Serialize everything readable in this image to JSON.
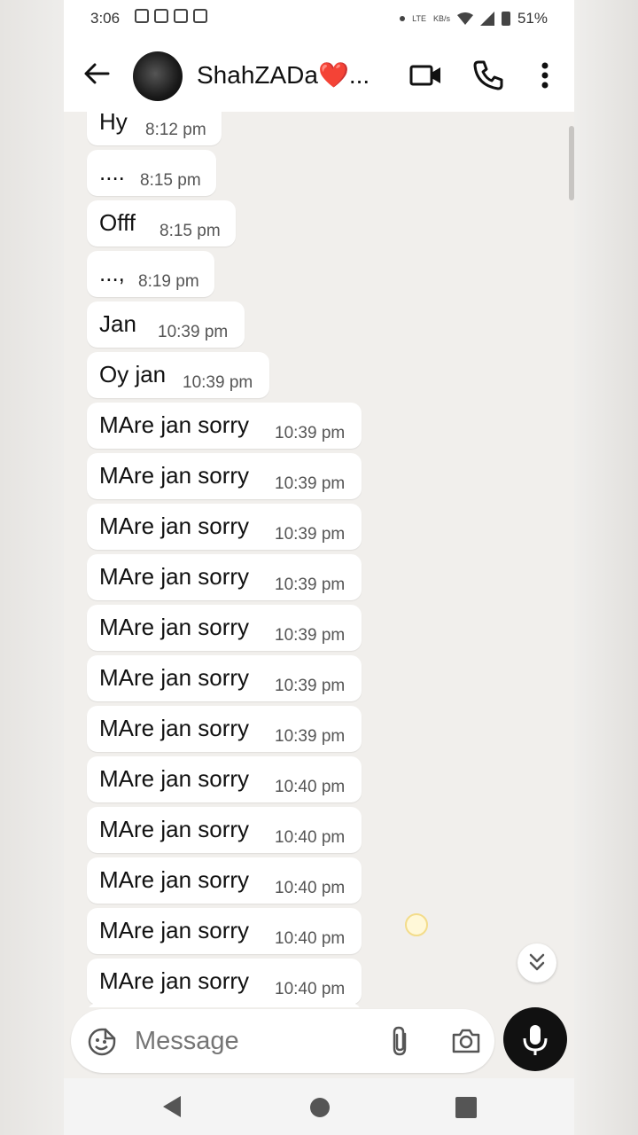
{
  "status_bar": {
    "time": "3:06",
    "battery": "51%",
    "lte_label": "LTE",
    "speed_label": "KB/s"
  },
  "header": {
    "contact_name": "ShahZADa❤️..."
  },
  "messages": [
    {
      "text": "Hy",
      "time": "8:12 pm"
    },
    {
      "text": "....",
      "time": "8:15 pm"
    },
    {
      "text": "Offf",
      "time": "8:15 pm"
    },
    {
      "text": "...,",
      "time": "8:19 pm"
    },
    {
      "text": "Jan",
      "time": "10:39 pm"
    },
    {
      "text": "Oy jan",
      "time": "10:39 pm"
    },
    {
      "text": "MAre jan sorry",
      "time": "10:39 pm"
    },
    {
      "text": "MAre jan sorry",
      "time": "10:39 pm"
    },
    {
      "text": "MAre jan sorry",
      "time": "10:39 pm"
    },
    {
      "text": "MAre jan sorry",
      "time": "10:39 pm"
    },
    {
      "text": "MAre jan sorry",
      "time": "10:39 pm"
    },
    {
      "text": "MAre jan sorry",
      "time": "10:39 pm"
    },
    {
      "text": "MAre jan sorry",
      "time": "10:39 pm"
    },
    {
      "text": "MAre jan sorry",
      "time": "10:40 pm"
    },
    {
      "text": "MAre jan sorry",
      "time": "10:40 pm"
    },
    {
      "text": "MAre jan sorry",
      "time": "10:40 pm"
    },
    {
      "text": "MAre jan sorry",
      "time": "10:40 pm"
    },
    {
      "text": "MAre jan sorry",
      "time": "10:40 pm"
    }
  ],
  "composer": {
    "placeholder": "Message"
  },
  "icons": {
    "back": "arrow-left-icon",
    "video": "video-camera-icon",
    "call": "phone-icon",
    "menu": "more-vertical-icon",
    "emoji": "sticker-emoji-icon",
    "attach": "paperclip-icon",
    "camera": "camera-icon",
    "mic": "microphone-icon",
    "scroll_down": "double-chevron-down-icon"
  },
  "colors": {
    "chat_bg": "#f1efec",
    "bubble": "#ffffff",
    "mic_button": "#111111"
  }
}
